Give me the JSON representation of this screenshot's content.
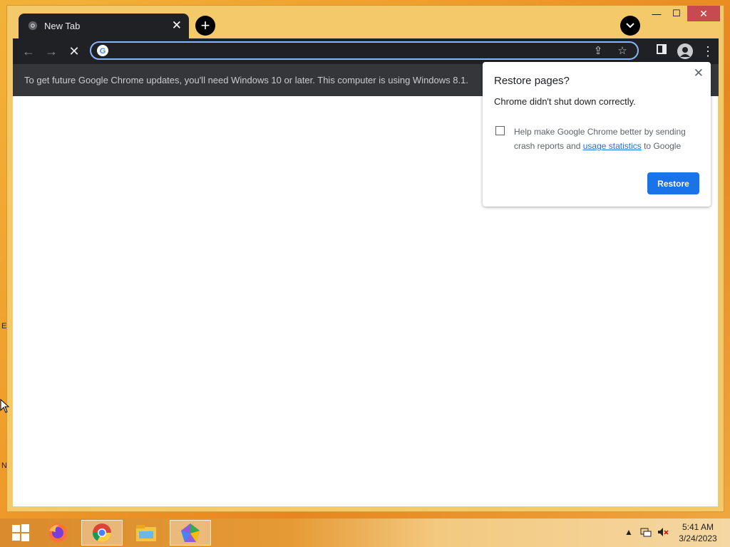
{
  "browser": {
    "tab": {
      "title": "New Tab",
      "close_glyph": "✕"
    },
    "new_tab_glyph": "+",
    "window_controls": {
      "minimize": "—",
      "maximize": "☐",
      "close": "✕"
    },
    "omnibox": {
      "value": "",
      "placeholder": ""
    },
    "infobar_message": "To get future Google Chrome updates, you'll need Windows 10 or later. This computer is using Windows 8.1."
  },
  "restore_popup": {
    "title": "Restore pages?",
    "message": "Chrome didn't shut down correctly.",
    "close_glyph": "✕",
    "checkbox_text_before": "Help make Google Chrome better by sending crash reports and ",
    "checkbox_link": "usage statistics",
    "checkbox_text_after": " to Google",
    "restore_button": "Restore",
    "accent_color": "#1a73e8"
  },
  "desktop": {
    "edge_letters": [
      "E",
      "N"
    ]
  },
  "taskbar": {
    "apps": [
      "windows-start-icon",
      "firefox-icon",
      "chrome-icon",
      "file-explorer-icon",
      "app-icon"
    ],
    "clock": {
      "time": "5:41 AM",
      "date": "3/24/2023"
    }
  }
}
